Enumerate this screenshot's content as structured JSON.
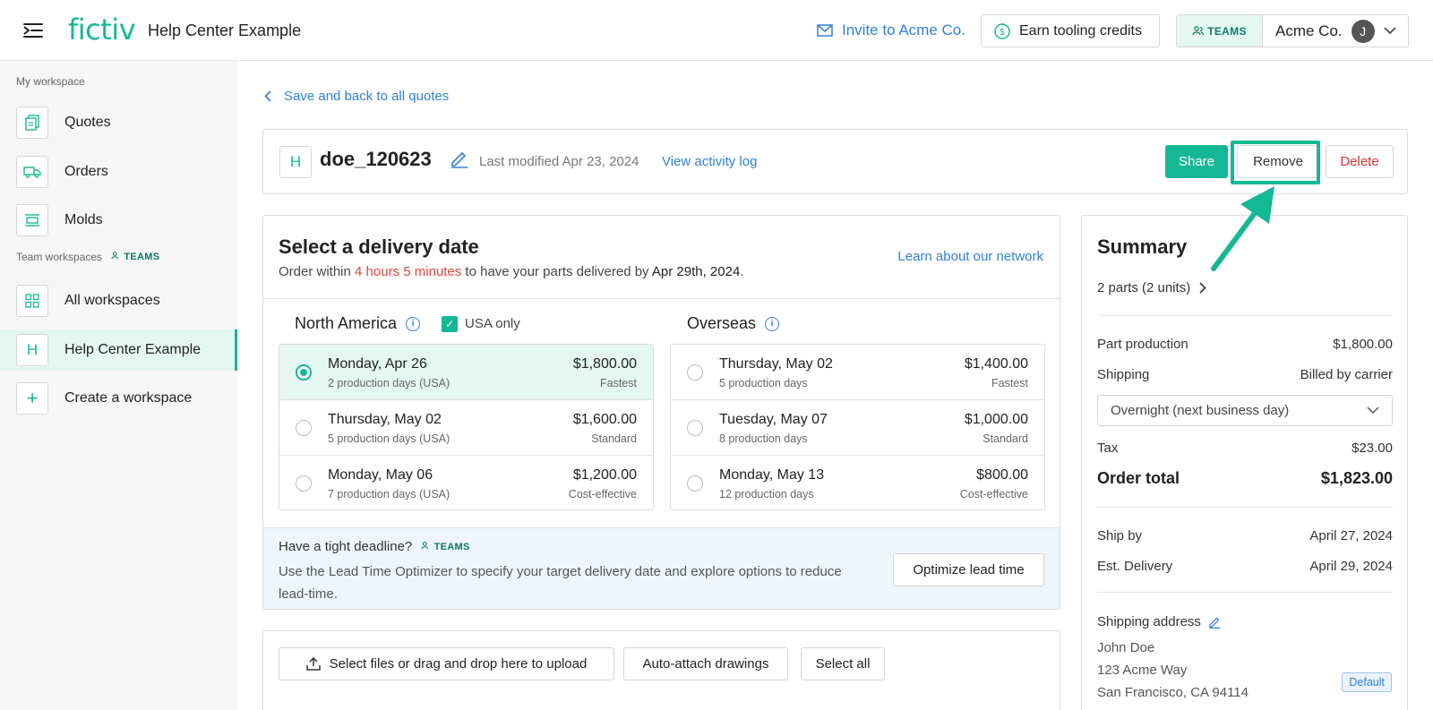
{
  "header": {
    "logo": "fictiv",
    "title": "Help Center Example",
    "invite": "Invite to Acme Co.",
    "earn": "Earn tooling credits",
    "teams_badge": "TEAMS",
    "account": "Acme Co.",
    "avatar_initial": "J"
  },
  "sidebar": {
    "my_workspace_label": "My workspace",
    "my_items": [
      {
        "label": "Quotes",
        "icon": "quotes-icon"
      },
      {
        "label": "Orders",
        "icon": "truck-icon"
      },
      {
        "label": "Molds",
        "icon": "molds-icon"
      }
    ],
    "team_label": "Team workspaces",
    "team_badge": "TEAMS",
    "team_items": [
      {
        "label": "All workspaces",
        "icon": "grid-icon"
      },
      {
        "label": "Help Center Example",
        "icon_text": "H",
        "active": true
      },
      {
        "label": "Create a workspace",
        "icon_text": "+"
      }
    ]
  },
  "main": {
    "back_link": "Save and back to all quotes",
    "quote": {
      "letter": "H",
      "name": "doe_120623",
      "last_modified": "Last modified Apr 23, 2024",
      "activity_link": "View activity log",
      "share": "Share",
      "remove": "Remove",
      "delete": "Delete"
    },
    "delivery": {
      "title": "Select a delivery date",
      "sub_pre": "Order within ",
      "sub_time": "4 hours 5 minutes",
      "sub_mid": " to have your parts delivered by ",
      "sub_date": "Apr 29th, 2024",
      "sub_end": ".",
      "learn": "Learn about our network",
      "na_title": "North America",
      "usa_only": "USA only",
      "overseas_title": "Overseas",
      "na_options": [
        {
          "date": "Monday, Apr 26",
          "days": "2 production days (USA)",
          "price": "$1,800.00",
          "tag": "Fastest"
        },
        {
          "date": "Thursday, May 02",
          "days": "5 production days (USA)",
          "price": "$1,600.00",
          "tag": "Standard"
        },
        {
          "date": "Monday, May 06",
          "days": "7 production days (USA)",
          "price": "$1,200.00",
          "tag": "Cost-effective"
        }
      ],
      "os_options": [
        {
          "date": "Thursday, May 02",
          "days": "5 production days",
          "price": "$1,400.00",
          "tag": "Fastest"
        },
        {
          "date": "Tuesday, May 07",
          "days": "8 production days",
          "price": "$1,000.00",
          "tag": "Standard"
        },
        {
          "date": "Monday, May 13",
          "days": "12 production days",
          "price": "$800.00",
          "tag": "Cost-effective"
        }
      ],
      "deadline_title": "Have a tight deadline?",
      "deadline_badge": "TEAMS",
      "deadline_text": "Use the Lead Time Optimizer to specify your target delivery date and explore options to reduce lead-time.",
      "optimize": "Optimize lead time"
    },
    "upload": {
      "select_files": "Select files or drag and drop here to upload",
      "auto_attach": "Auto-attach drawings",
      "select_all": "Select all"
    }
  },
  "summary": {
    "title": "Summary",
    "parts": "2 parts (2 units)",
    "part_production_label": "Part production",
    "part_production_value": "$1,800.00",
    "shipping_label": "Shipping",
    "shipping_value": "Billed by carrier",
    "shipping_method": "Overnight (next business day)",
    "tax_label": "Tax",
    "tax_value": "$23.00",
    "total_label": "Order total",
    "total_value": "$1,823.00",
    "ship_by_label": "Ship by",
    "ship_by_value": "April 27, 2024",
    "est_label": "Est. Delivery",
    "est_value": "April 29, 2024",
    "address_title": "Shipping address",
    "address_lines": [
      "John Doe",
      "123 Acme Way",
      "San Francisco, CA 94114"
    ],
    "default_badge": "Default"
  },
  "colors": {
    "brand": "#15b896",
    "link": "#2f80d9",
    "danger": "#e0463e"
  }
}
